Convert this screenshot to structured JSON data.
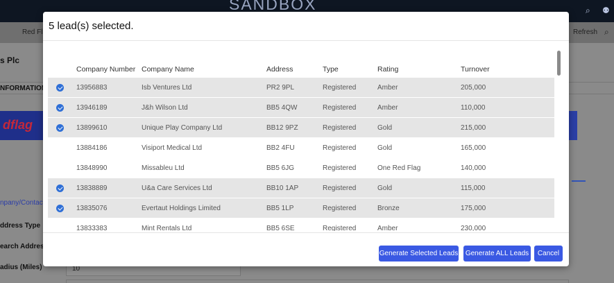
{
  "background": {
    "brand_text": "SANDBOX",
    "subbar": {
      "red_flag_label": "Red Fla",
      "refresh_label": "Refresh"
    },
    "company_title": "s Plc",
    "information_label": "NFORMATION",
    "banner_logo_text": "dflag",
    "side_labels": {
      "company_contact": "npany/Contact",
      "address_type": "ddress Type",
      "search_address": "earch Address",
      "radius": "adius (Miles)"
    },
    "radius_value": "10"
  },
  "modal": {
    "title": "5 lead(s) selected.",
    "columns": [
      "Company Number",
      "Company Name",
      "Address",
      "Type",
      "Rating",
      "Turnover"
    ],
    "rows": [
      {
        "selected": true,
        "company_number": "13956883",
        "company_name": "Isb Ventures Ltd",
        "address": "PR2 9PL",
        "type": "Registered",
        "rating": "Amber",
        "turnover": "205,000"
      },
      {
        "selected": true,
        "company_number": "13946189",
        "company_name": "J&h Wilson Ltd",
        "address": "BB5 4QW",
        "type": "Registered",
        "rating": "Amber",
        "turnover": "110,000"
      },
      {
        "selected": true,
        "company_number": "13899610",
        "company_name": "Unique Play Company Ltd",
        "address": "BB12 9PZ",
        "type": "Registered",
        "rating": "Gold",
        "turnover": "215,000"
      },
      {
        "selected": false,
        "company_number": "13884186",
        "company_name": "Visiport Medical Ltd",
        "address": "BB2 4FU",
        "type": "Registered",
        "rating": "Gold",
        "turnover": "165,000"
      },
      {
        "selected": false,
        "company_number": "13848990",
        "company_name": "Missableu Ltd",
        "address": "BB5 6JG",
        "type": "Registered",
        "rating": "One Red Flag",
        "turnover": "140,000"
      },
      {
        "selected": true,
        "company_number": "13838889",
        "company_name": "U&a Care Services Ltd",
        "address": "BB10 1AP",
        "type": "Registered",
        "rating": "Gold",
        "turnover": "115,000"
      },
      {
        "selected": true,
        "company_number": "13835076",
        "company_name": "Evertaut Holdings Limited",
        "address": "BB5 1LP",
        "type": "Registered",
        "rating": "Bronze",
        "turnover": "175,000"
      },
      {
        "selected": false,
        "company_number": "13833383",
        "company_name": "Mint Rentals Ltd",
        "address": "BB5 6SE",
        "type": "Registered",
        "rating": "Amber",
        "turnover": "230,000"
      }
    ],
    "buttons": {
      "generate_selected": "Generate Selected Leads",
      "generate_all": "Generate ALL Leads",
      "cancel": "Cancel"
    }
  },
  "icons": {
    "search": "search-icon",
    "location": "location-icon",
    "check": "check-circle-icon"
  },
  "colors": {
    "accent": "#3a59e3",
    "check": "#2f6fd6",
    "selected_row": "#e5e5e5"
  }
}
